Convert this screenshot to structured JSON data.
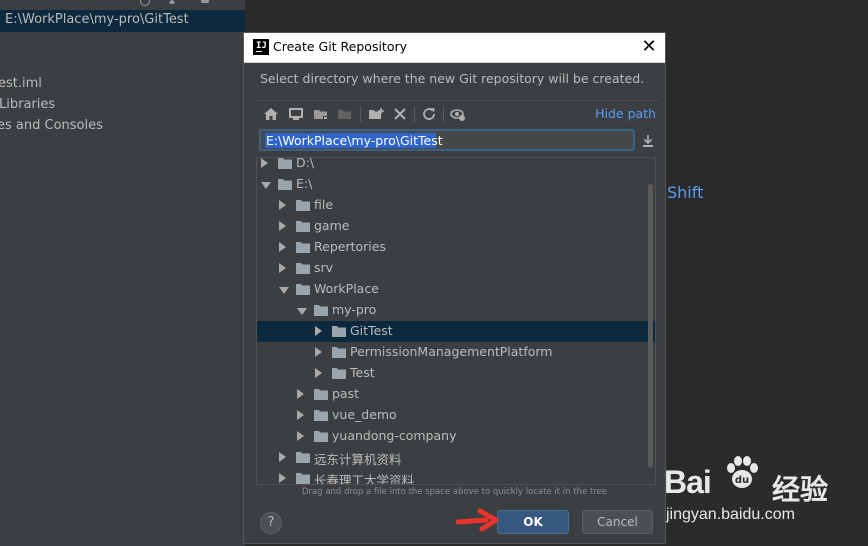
{
  "ide": {
    "project_path": "E:\\WorkPlace\\my-pro\\GitTest",
    "tree_items": [
      "est.iml",
      "Libraries",
      "es and Consoles"
    ],
    "right_hint": "Shift"
  },
  "dialog": {
    "title": "Create Git Repository",
    "close_label": "✕",
    "description": "Select directory where the new Git repository will be created.",
    "toolbar": {
      "icons": [
        "home-icon",
        "desktop-icon",
        "project-folder-icon",
        "module-folder-icon",
        "new-folder-icon",
        "delete-icon",
        "refresh-icon",
        "show-hidden-icon"
      ],
      "hide_path_label": "Hide path"
    },
    "path_value": "E:\\WorkPlace\\my-pro\\GitTest",
    "tree": {
      "rows": [
        {
          "label": "D:\\",
          "expanded": false,
          "selected": false
        },
        {
          "label": "E:\\",
          "expanded": true,
          "selected": false
        },
        {
          "label": "file",
          "expanded": false,
          "selected": false
        },
        {
          "label": "game",
          "expanded": false,
          "selected": false
        },
        {
          "label": "Repertories",
          "expanded": false,
          "selected": false
        },
        {
          "label": "srv",
          "expanded": false,
          "selected": false
        },
        {
          "label": "WorkPlace",
          "expanded": true,
          "selected": false
        },
        {
          "label": "my-pro",
          "expanded": true,
          "selected": false
        },
        {
          "label": "GitTest",
          "expanded": false,
          "selected": true
        },
        {
          "label": "PermissionManagementPlatform",
          "expanded": false,
          "selected": false
        },
        {
          "label": "Test",
          "expanded": false,
          "selected": false
        },
        {
          "label": "past",
          "expanded": false,
          "selected": false
        },
        {
          "label": "vue_demo",
          "expanded": false,
          "selected": false
        },
        {
          "label": "yuandong-company",
          "expanded": false,
          "selected": false
        },
        {
          "label": "远东计算机资料",
          "expanded": false,
          "selected": false
        },
        {
          "label": "长春理工大学资料",
          "expanded": false,
          "selected": false
        }
      ]
    },
    "hint": "Drag and drop a file into the space above to quickly locate it in the tree",
    "help_label": "?",
    "ok_label": "OK",
    "cancel_label": "Cancel"
  },
  "watermark": {
    "brand_latin": "Bai",
    "brand_cn": "经验",
    "url": "jingyan.baidu.com"
  },
  "colors": {
    "dialog_bg": "#3c3f41",
    "selection": "#0d293e",
    "link": "#589df6",
    "ok_button": "#365880",
    "annotation_arrow": "#e8322c"
  }
}
